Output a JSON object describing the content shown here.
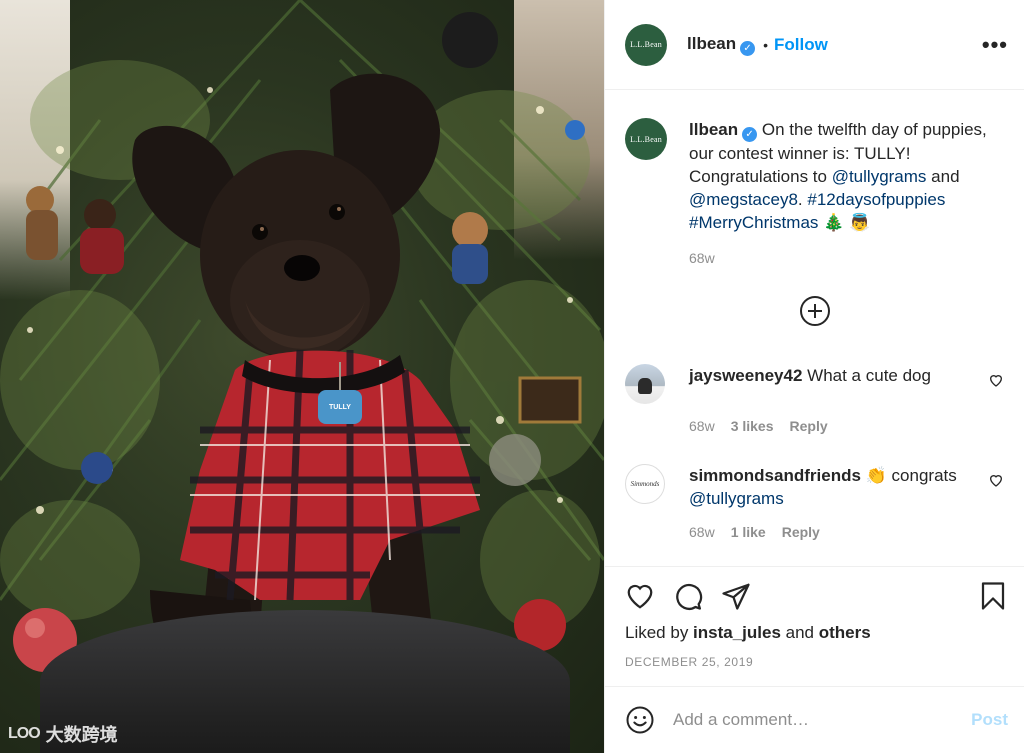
{
  "post": {
    "image_alt": "Small black terrier in a red plaid shirt sitting in front of a Christmas tree",
    "tag_text": "TULLY",
    "watermark": "大数跨境"
  },
  "header": {
    "avatar_text": "L.L.Bean",
    "username": "llbean",
    "separator": "•",
    "follow_label": "Follow",
    "more_label": "•••"
  },
  "caption": {
    "username": "llbean",
    "text_1": "On the twelfth day of puppies, our contest winner is: TULLY! Congratulations to ",
    "mention_1": "@tullygrams",
    "text_2": " and ",
    "mention_2": "@megstacey8",
    "text_3": ". ",
    "hashtag_1": "#12daysofpuppies",
    "hashtag_2": "#MerryChristmas",
    "emoji": "🎄 👼",
    "time": "68w"
  },
  "comments": [
    {
      "username": "jaysweeney42",
      "text": "What a cute dog",
      "time": "68w",
      "likes": "3 likes",
      "reply": "Reply"
    },
    {
      "username": "simmondsandfriends",
      "avatar_text": "Simmonds",
      "text": "👏 congrats ",
      "mention": "@tullygrams",
      "time": "68w",
      "likes": "1 like",
      "reply": "Reply"
    }
  ],
  "actions": {
    "liked_prefix": "Liked by ",
    "liked_user": "insta_jules",
    "liked_middle": " and ",
    "liked_suffix": "others",
    "date": "DECEMBER 25, 2019"
  },
  "add_comment": {
    "placeholder": "Add a comment…",
    "post_label": "Post"
  },
  "colors": {
    "accent": "#0095f6",
    "link": "#00376b",
    "muted": "#8e8e8e",
    "avatar_green": "#2c5e3f",
    "verified": "#3897f0"
  }
}
